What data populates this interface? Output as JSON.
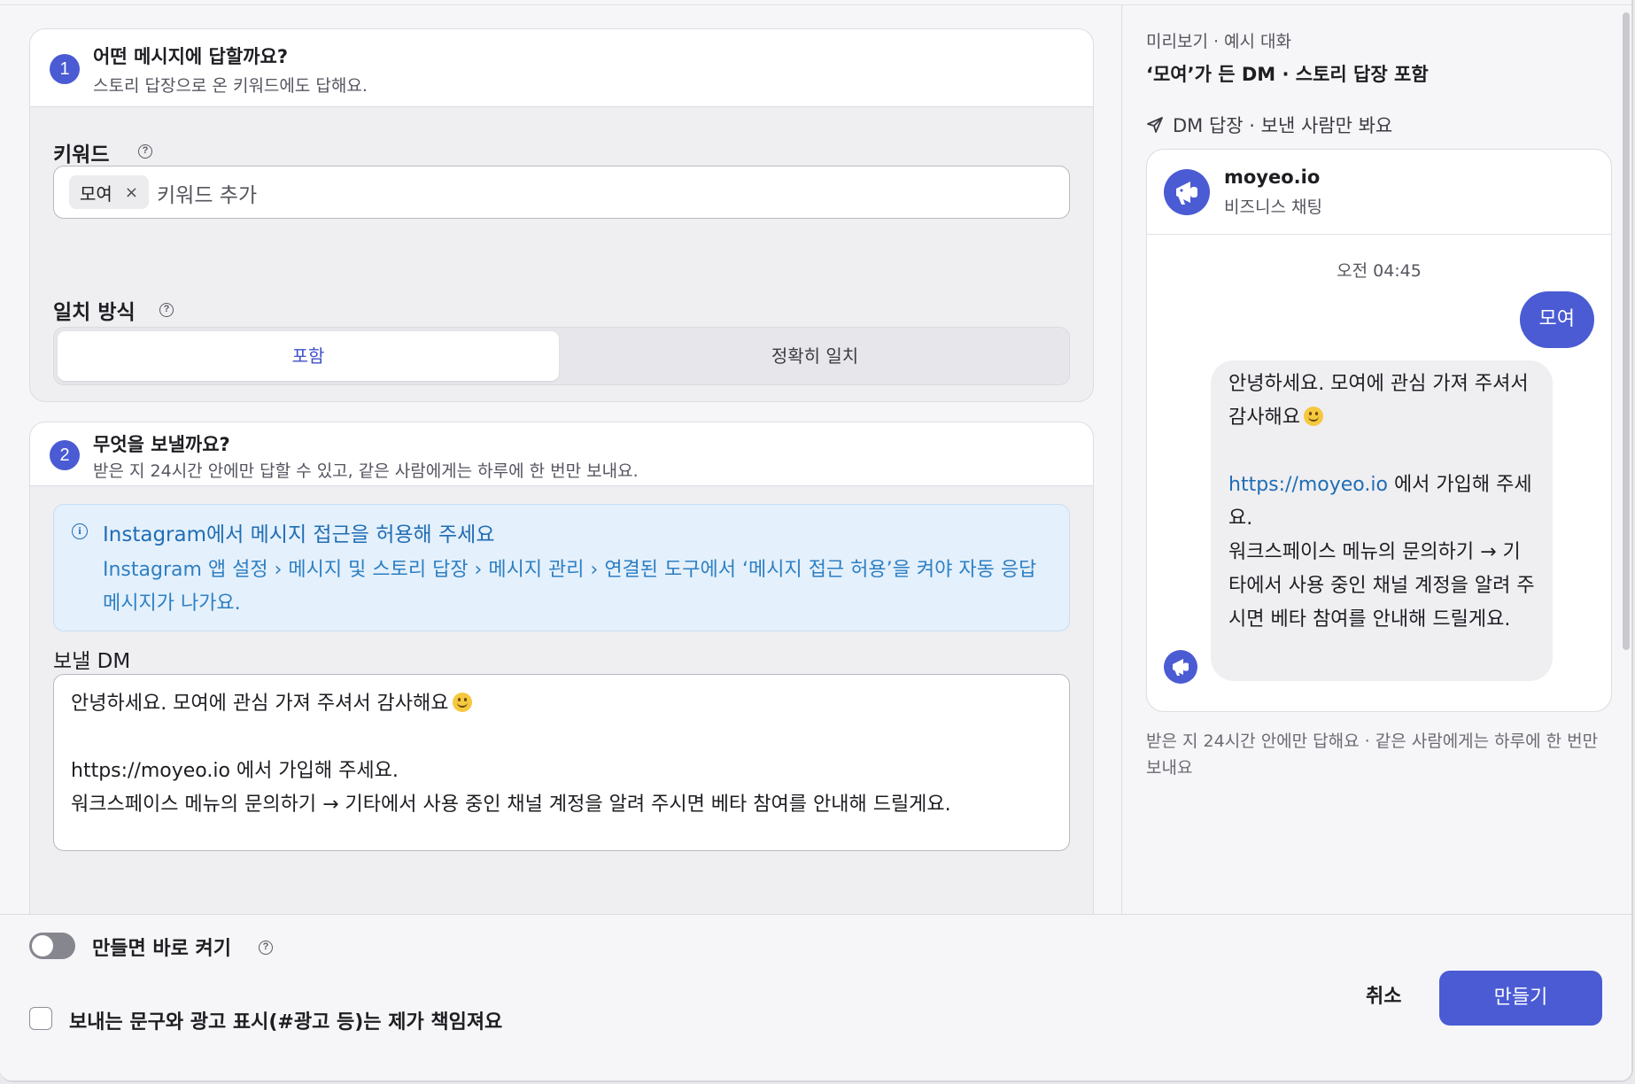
{
  "step1": {
    "number": "1",
    "title": "어떤 메시지에 답할까요?",
    "subtitle": "스토리 답장으로 온 키워드에도 답해요.",
    "keyword_label": "키워드",
    "keyword_chip": "모여",
    "keyword_chip_remove": "×",
    "keyword_placeholder": "키워드 추가",
    "match_label": "일치 방식",
    "match_options": [
      "포함",
      "정확히 일치"
    ],
    "match_selected": "포함"
  },
  "step2": {
    "number": "2",
    "title": "무엇을 보낼까요?",
    "subtitle": "받은 지 24시간 안에만 답할 수 있고, 같은 사람에게는 하루에 한 번만 보내요.",
    "info_title": "Instagram에서 메시지 접근을 허용해 주세요",
    "info_body": "Instagram 앱 설정 › 메시지 및 스토리 답장 › 메시지 관리 › 연결된 도구에서 ‘메시지 접근 허용’을 켜야 자동 응답 메시지가 나가요.",
    "dm_label": "보낼 DM",
    "dm_line1": "안녕하세요. 모여에 관심 가져 주셔서 감사해요",
    "dm_line2": "https://moyeo.io 에서 가입해 주세요.",
    "dm_line3": "워크스페이스 메뉴의 문의하기 → 기타에서 사용 중인 채널 계정을 알려 주시면 베타 참여를 안내해 드릴게요."
  },
  "preview": {
    "caption": "미리보기 · 예시 대화",
    "title": "‘모여’가 든 DM · 스토리 답장 포함",
    "dm_note": "DM 답장 · 보낸 사람만 봐요",
    "account_name": "moyeo.io",
    "account_sub": "비즈니스 채팅",
    "time": "오전 04:45",
    "incoming": "모여",
    "reply_part1": "안녕하세요. 모여에 관심 가져 주셔서 감사해요",
    "reply_link": "https://moyeo.io",
    "reply_part2": " 에서 가입해 주세요.\n워크스페이스 메뉴의 문의하기 → 기타에서 사용 중인 채널 계정을 알려 주시면 베타 참여를 안내해 드릴게요.",
    "footnote": "받은 지 24시간 안에만 답해요 · 같은 사람에게는 하루에 한 번만 보내요"
  },
  "footer": {
    "toggle_label": "만들면 바로 켜기",
    "toggle_on": false,
    "checkbox_label": "보내는 문구와 광고 표시(#광고 등)는 제가 책임져요",
    "checkbox_checked": false,
    "cancel_label": "취소",
    "create_label": "만들기"
  },
  "icons": {
    "help": "help-circle-icon",
    "info": "info-circle-icon",
    "send": "send-icon",
    "emoji": "smiley-emoji-icon",
    "megaphone": "megaphone-avatar-icon"
  },
  "colors": {
    "accent": "#4a5bd4",
    "info_text": "#1f6db5",
    "info_bg": "#e4f0fb"
  }
}
